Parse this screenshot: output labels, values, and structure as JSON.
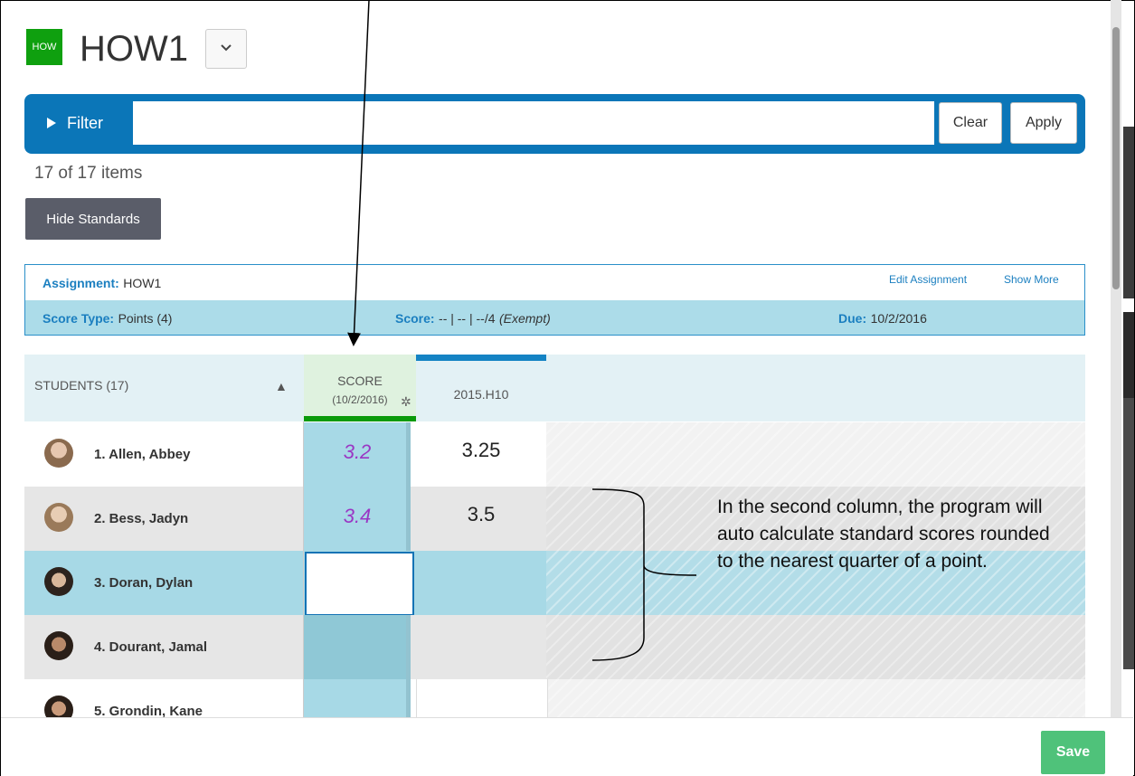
{
  "header": {
    "logo_text": "HOW",
    "title": "HOW1"
  },
  "filter": {
    "label": "Filter",
    "value": "",
    "clear_label": "Clear",
    "apply_label": "Apply"
  },
  "items_count": "17 of 17 items",
  "hide_standards_label": "Hide Standards",
  "assignment": {
    "assignment_label": "Assignment:",
    "assignment_value": "HOW1",
    "edit_link": "Edit Assignment",
    "show_more_link": "Show More",
    "score_type_label": "Score Type:",
    "score_type_value": "Points (4)",
    "score_label": "Score:",
    "score_value": "-- | -- | --/4",
    "score_exempt": "(Exempt)",
    "due_label": "Due:",
    "due_value": "10/2/2016"
  },
  "grid": {
    "students_header": "STUDENTS (17)",
    "score_header": "SCORE",
    "score_date": "(10/2/2016)",
    "standard_header": "2015.H10",
    "rows": [
      {
        "name": "1. Allen, Abbey",
        "score": "3.2",
        "standard": "3.25"
      },
      {
        "name": "2. Bess, Jadyn",
        "score": "3.4",
        "standard": "3.5"
      },
      {
        "name": "3. Doran, Dylan",
        "score": "",
        "standard": ""
      },
      {
        "name": "4. Dourant, Jamal",
        "score": "",
        "standard": ""
      },
      {
        "name": "5. Grondin, Kane",
        "score": "",
        "standard": ""
      }
    ]
  },
  "save_label": "Save",
  "annotation": "In the second column, the program will auto calculate standard scores rounded to the nearest quarter of a point.",
  "colors": {
    "accent": "#0b76b8",
    "brand": "#0fa00f",
    "score_text": "#9a37c4",
    "save": "#4fc27a"
  },
  "icons": {
    "title_dropdown": "chevron-down-icon",
    "filter_toggle": "play-triangle-icon",
    "sort": "triangle-up-icon",
    "score_settings": "gear-icon"
  }
}
